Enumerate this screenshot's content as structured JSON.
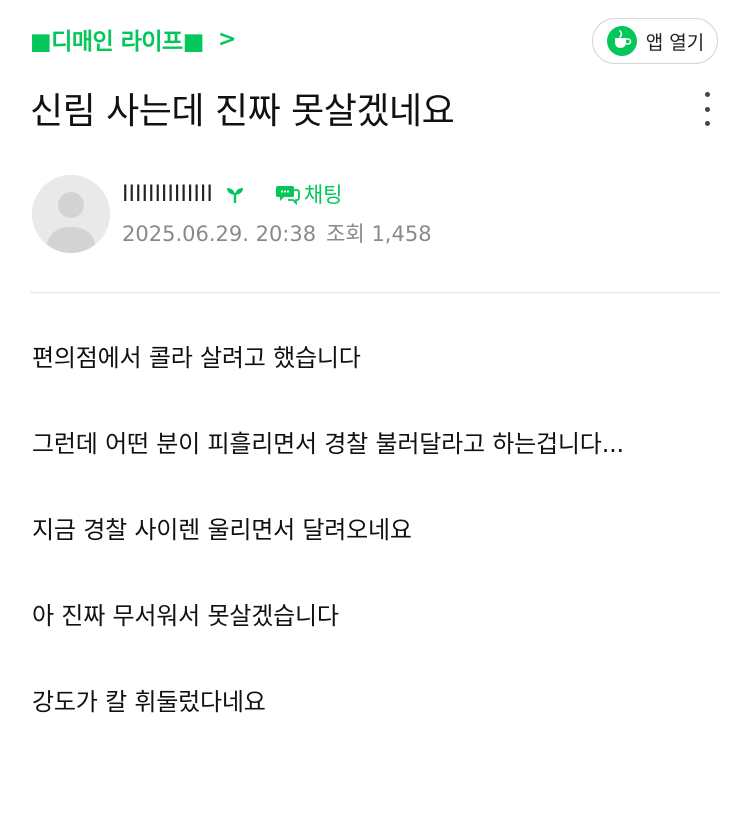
{
  "header": {
    "board_label": "■디매인 라이프■",
    "board_chevron": ">",
    "app_open_label": "앱 열기",
    "app_open_icon": "cup-icon"
  },
  "post": {
    "title": "신림 사는데 진짜 못살겠네요",
    "author": {
      "nickname": "IIIIIIIIIIIIII",
      "level_icon": "sprout-icon",
      "chat_label": "채팅",
      "chat_icon": "chat-bubble-icon"
    },
    "date": "2025.06.29. 20:38",
    "views_label": "조회",
    "views": "1,458",
    "paragraphs": [
      "편의점에서 콜라 살려고 했습니다",
      "그런데 어떤 분이 피흘리면서 경찰 불러달라고 하는겁니다...",
      "지금 경찰 사이렌 울리면서 달려오네요",
      "아 진짜 무서워서 못살겠습니다",
      "강도가 칼 휘둘렀다네요"
    ]
  },
  "colors": {
    "accent_green": "#03c75a",
    "meta_gray": "#8a8a8a",
    "text": "#111111"
  }
}
